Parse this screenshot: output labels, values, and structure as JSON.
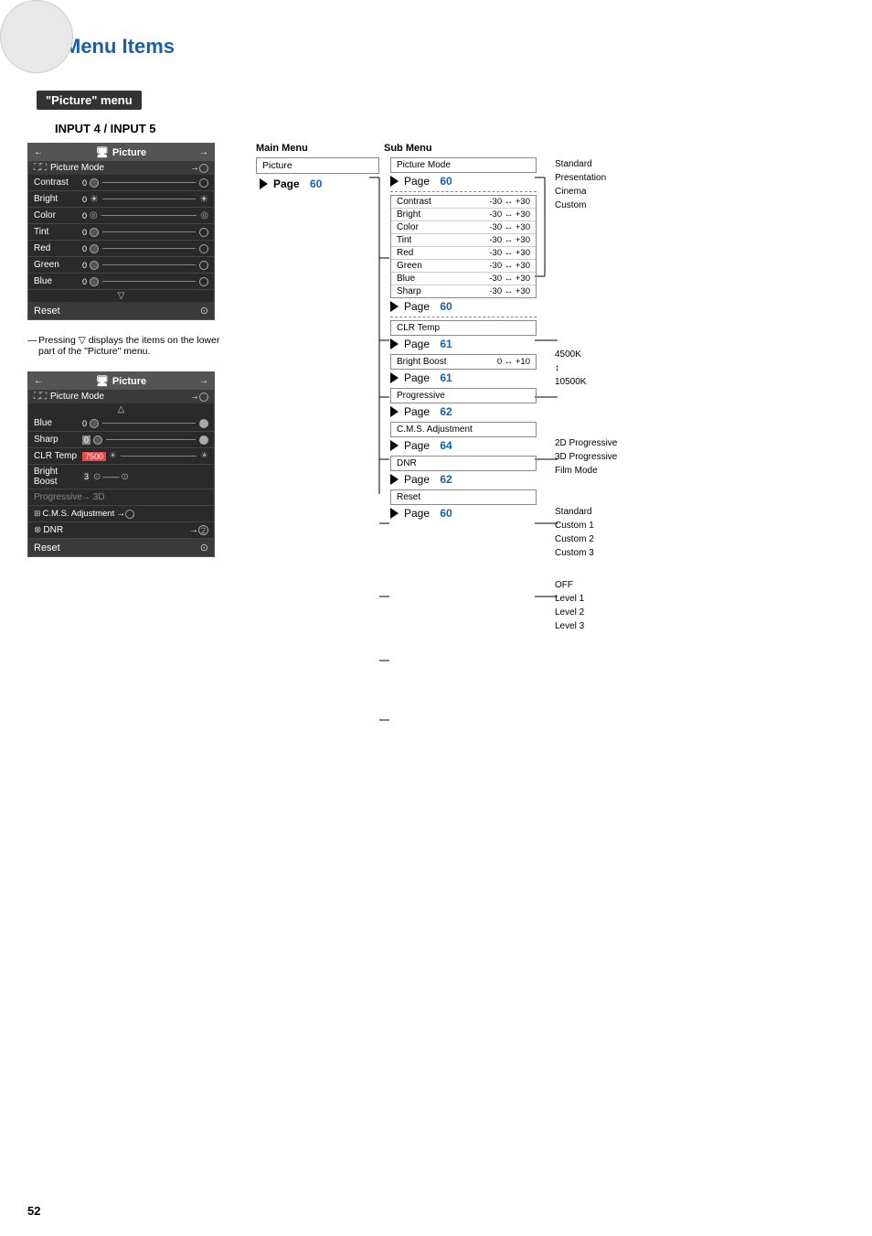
{
  "page": {
    "number": "52",
    "title": "Menu Items"
  },
  "section": {
    "label": "\"Picture\" menu",
    "input_label": "INPUT 4 / INPUT 5"
  },
  "menu_headers": {
    "main": "Main Menu",
    "sub": "Sub Menu"
  },
  "top_menu_box": {
    "title": "Picture",
    "mode_row": {
      "label": "Picture Mode",
      "arrow": "→"
    },
    "rows": [
      {
        "label": "Contrast",
        "value": "0"
      },
      {
        "label": "Bright",
        "value": "0"
      },
      {
        "label": "Color",
        "value": "0"
      },
      {
        "label": "Tint",
        "value": "0"
      },
      {
        "label": "Red",
        "value": "0"
      },
      {
        "label": "Green",
        "value": "0"
      },
      {
        "label": "Blue",
        "value": "0"
      }
    ],
    "footer": "Reset"
  },
  "bottom_menu_box": {
    "title": "Picture",
    "mode_row": {
      "label": "Picture Mode",
      "arrow": "→"
    },
    "rows": [
      {
        "label": "Blue",
        "value": "0"
      },
      {
        "label": "Sharp",
        "value": "0"
      },
      {
        "label": "CLR Temp",
        "value": "7500"
      },
      {
        "label": "Bright Boost",
        "value": "3"
      },
      {
        "label": "Progressive",
        "value": ""
      },
      {
        "label": "C.M.S. Adjustment",
        "value": ""
      },
      {
        "label": "DNR",
        "value": ""
      }
    ],
    "footer": "Reset"
  },
  "pressing_note": "Pressing ▽ displays the items on the lower part of the \"Picture\" menu.",
  "main_menu": {
    "item": "Picture",
    "page_label": "Page",
    "page_num": "60"
  },
  "sub_menu": {
    "picture_mode_label": "Picture Mode",
    "picture_mode_page": "60",
    "adjustment_items": [
      {
        "label": "Contrast",
        "range": "-30 ↔ +30"
      },
      {
        "label": "Bright",
        "range": "-30 ↔ +30"
      },
      {
        "label": "Color",
        "range": "-30 ↔ +30"
      },
      {
        "label": "Tint",
        "range": "-30 ↔ +30"
      },
      {
        "label": "Red",
        "range": "-30 ↔ +30"
      },
      {
        "label": "Green",
        "range": "-30 ↔ +30"
      },
      {
        "label": "Blue",
        "range": "-30 ↔ +30"
      },
      {
        "label": "Sharp",
        "range": "-30 ↔ +30"
      }
    ],
    "clr_temp_label": "CLR Temp",
    "clr_temp_page": "61",
    "bright_boost_label": "Bright Boost",
    "bright_boost_range": "0 ↔ +10",
    "bright_boost_page": "61",
    "progressive_label": "Progressive",
    "progressive_page": "62",
    "cms_label": "C.M.S. Adjustment",
    "cms_page": "64",
    "dnr_label": "DNR",
    "dnr_page": "62",
    "reset_label": "Reset",
    "reset_page": "60"
  },
  "options": {
    "picture_mode": [
      "Standard",
      "Presentation",
      "Cinema",
      "Custom"
    ],
    "clr_temp": [
      "4500K",
      "↕",
      "10500K"
    ],
    "progressive": [
      "2D Progressive",
      "3D Progressive",
      "Film Mode"
    ],
    "cms": [
      "Standard",
      "Custom 1",
      "Custom 2",
      "Custom 3"
    ],
    "dnr": [
      "OFF",
      "Level 1",
      "Level 2",
      "Level 3"
    ]
  }
}
